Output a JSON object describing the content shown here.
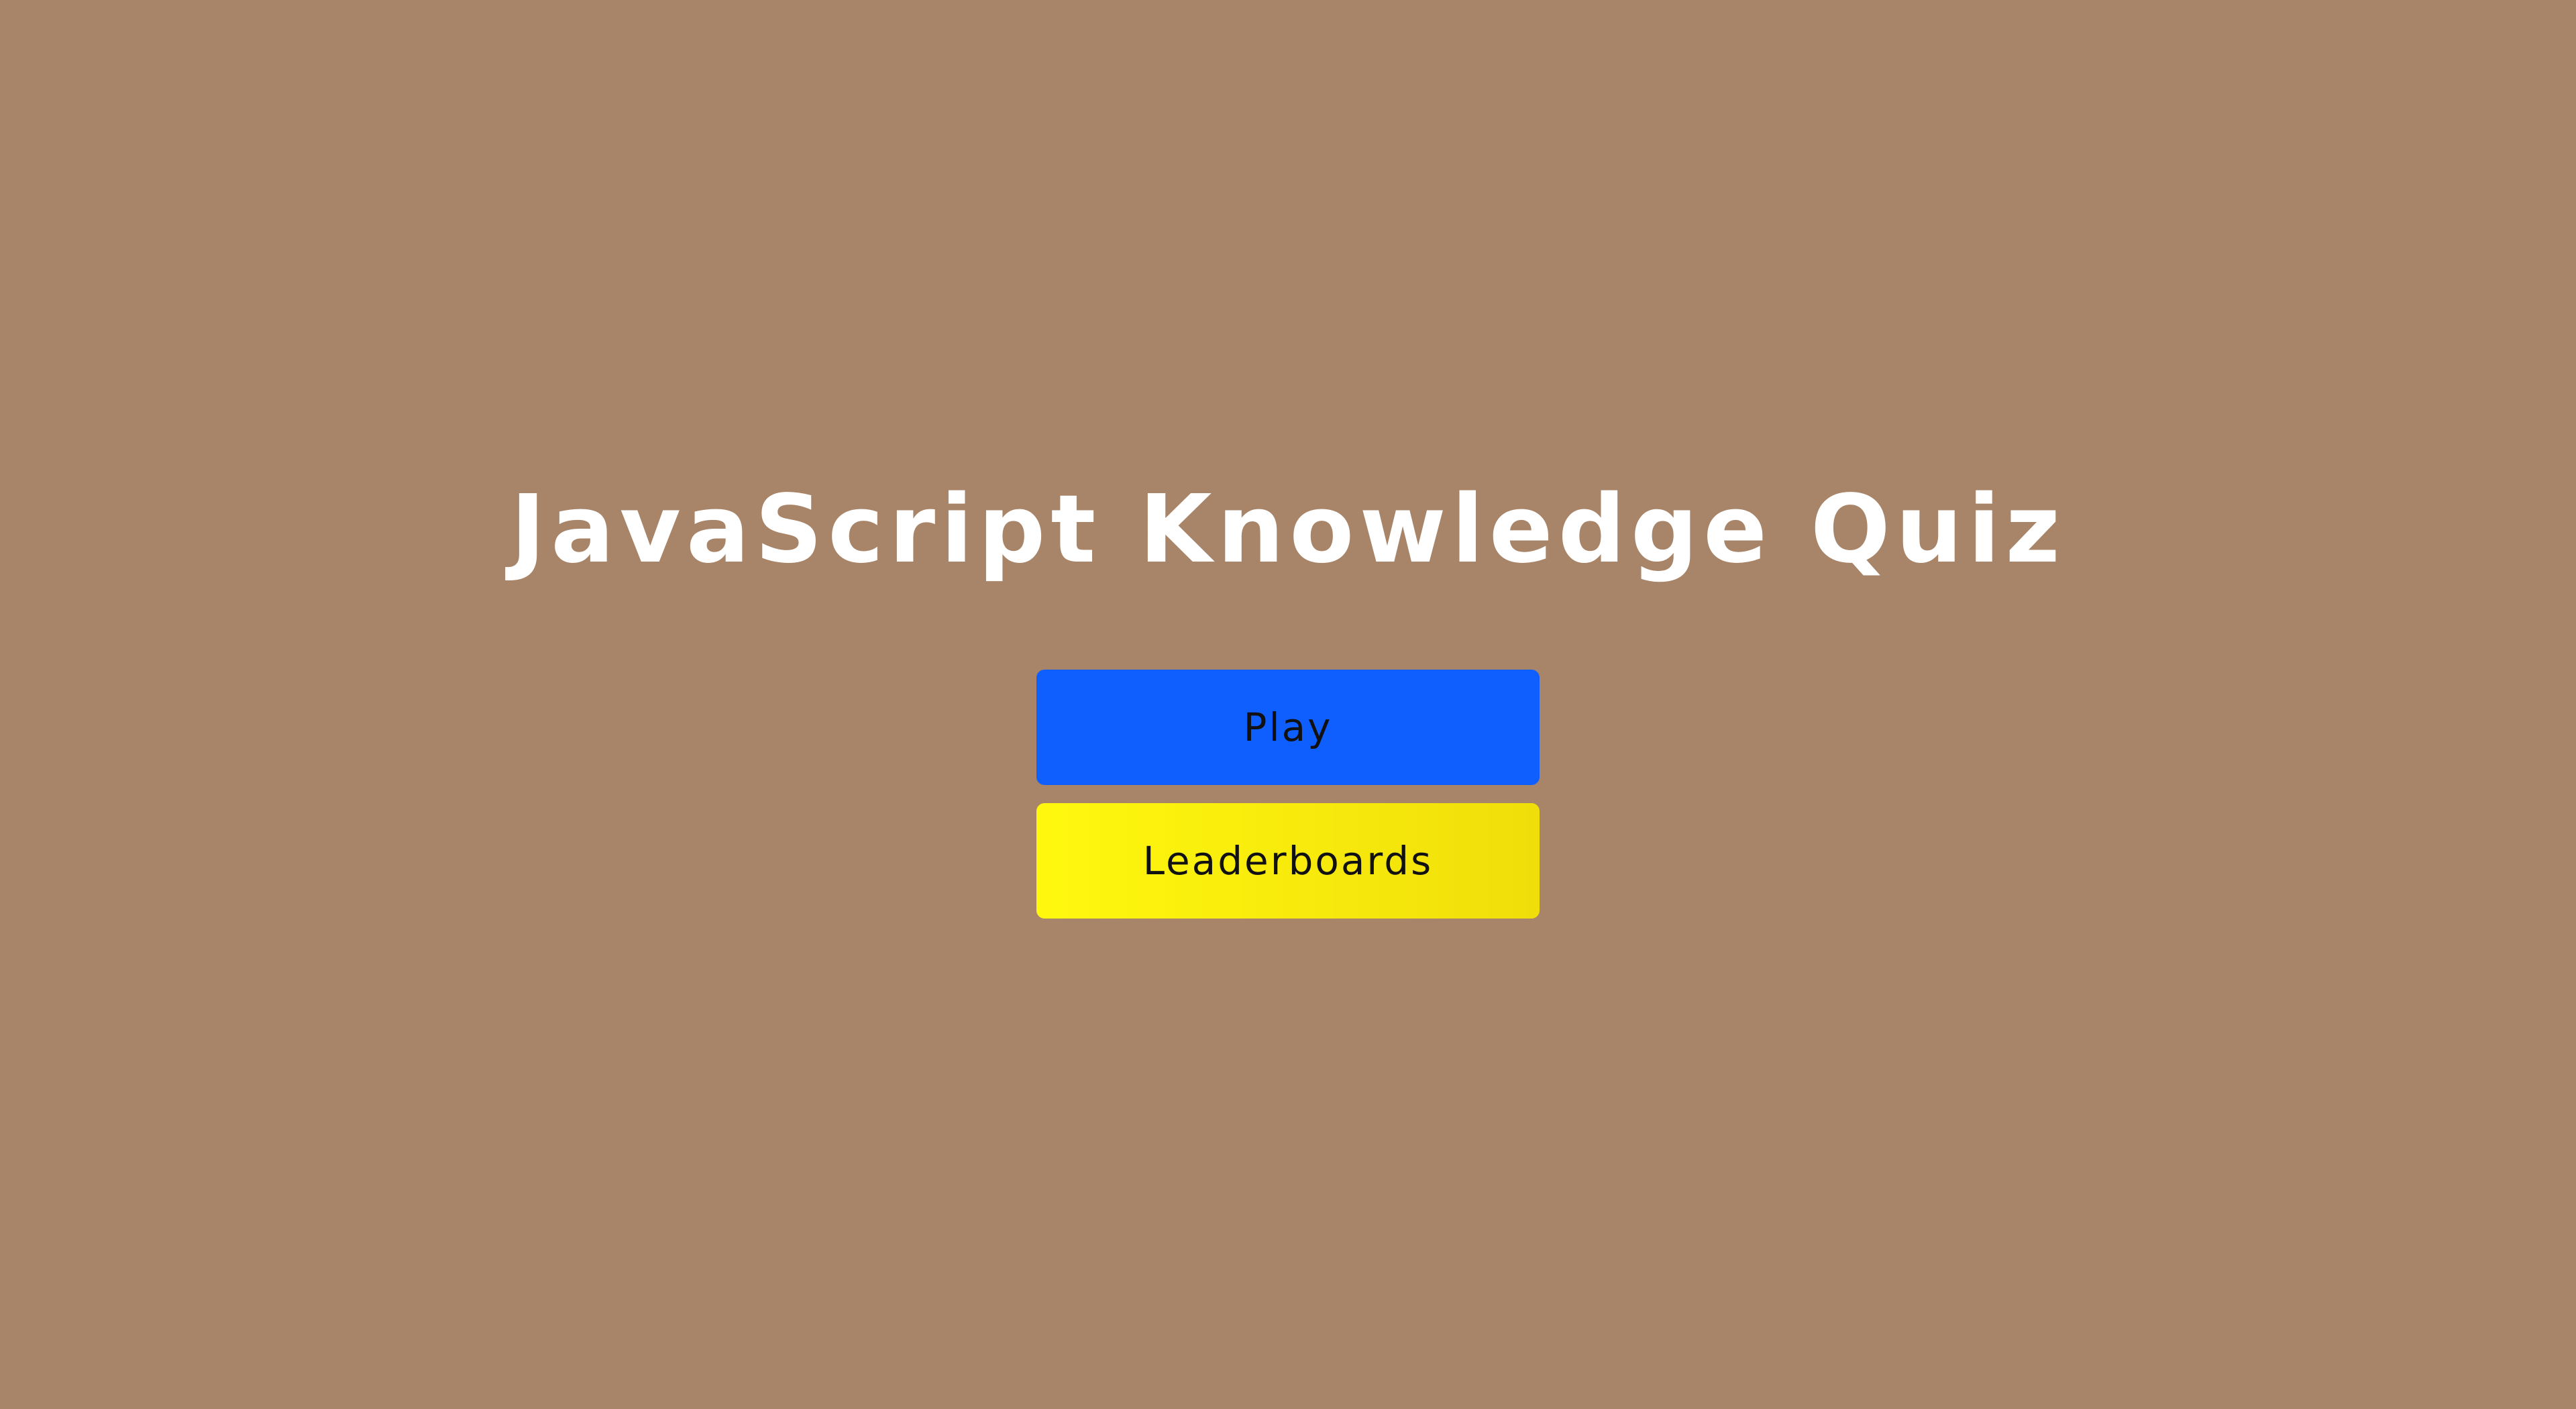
{
  "title": "JavaScript Knowledge Quiz",
  "buttons": {
    "play_label": "Play",
    "leaderboards_label": "Leaderboards"
  },
  "colors": {
    "background": "#a88468",
    "title_text": "#ffffff",
    "play_button": "#0f5fff",
    "leaderboards_button": "#fff80e",
    "button_text": "#111111"
  }
}
